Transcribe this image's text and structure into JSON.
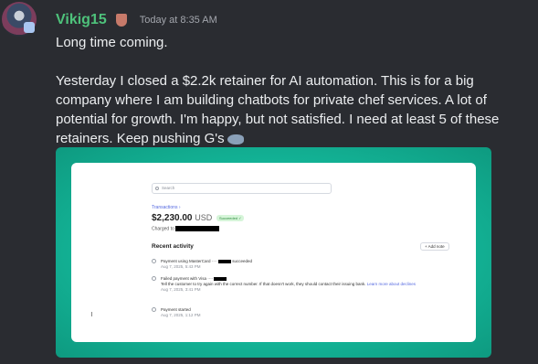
{
  "message": {
    "username": "Vikig15",
    "timestamp": "Today at 8:35 AM",
    "line1": "Long time coming.",
    "line2": "Yesterday I closed a $2.2k retainer for AI automation. This is for a big company where I am building chatbots for private chef services. A lot of potential for growth. I'm happy, but not satisfied. I need at least 5 of these retainers. Keep pushing G's"
  },
  "embed": {
    "search_placeholder": "Search",
    "breadcrumb": "Transactions ›",
    "amount": "$2,230.00",
    "currency": "USD",
    "status": "Succeeded ✓",
    "charged_label": "Charged to",
    "recent_title": "Recent activity",
    "add_note": "+ Add note",
    "activities": [
      {
        "text": "Payment using MasterCard ···· ",
        "suffix": " succeeded",
        "time": "Aug 7, 2025, 5:43 PM"
      },
      {
        "text": "Failed payment with Visa ···· ",
        "suffix": "",
        "detail": "Tell the customer to try again with the correct number. If that doesn't work, they should contact their issuing bank.",
        "link": "Learn more about declines",
        "time": "Aug 7, 2025, 3:41 PM"
      },
      {
        "text": "Payment started",
        "suffix": "",
        "time": "Aug 7, 2025, 1:12 PM"
      }
    ]
  },
  "colors": {
    "username": "#4ec27b",
    "background": "#2a2c31",
    "embed_bg": "#13b396"
  }
}
